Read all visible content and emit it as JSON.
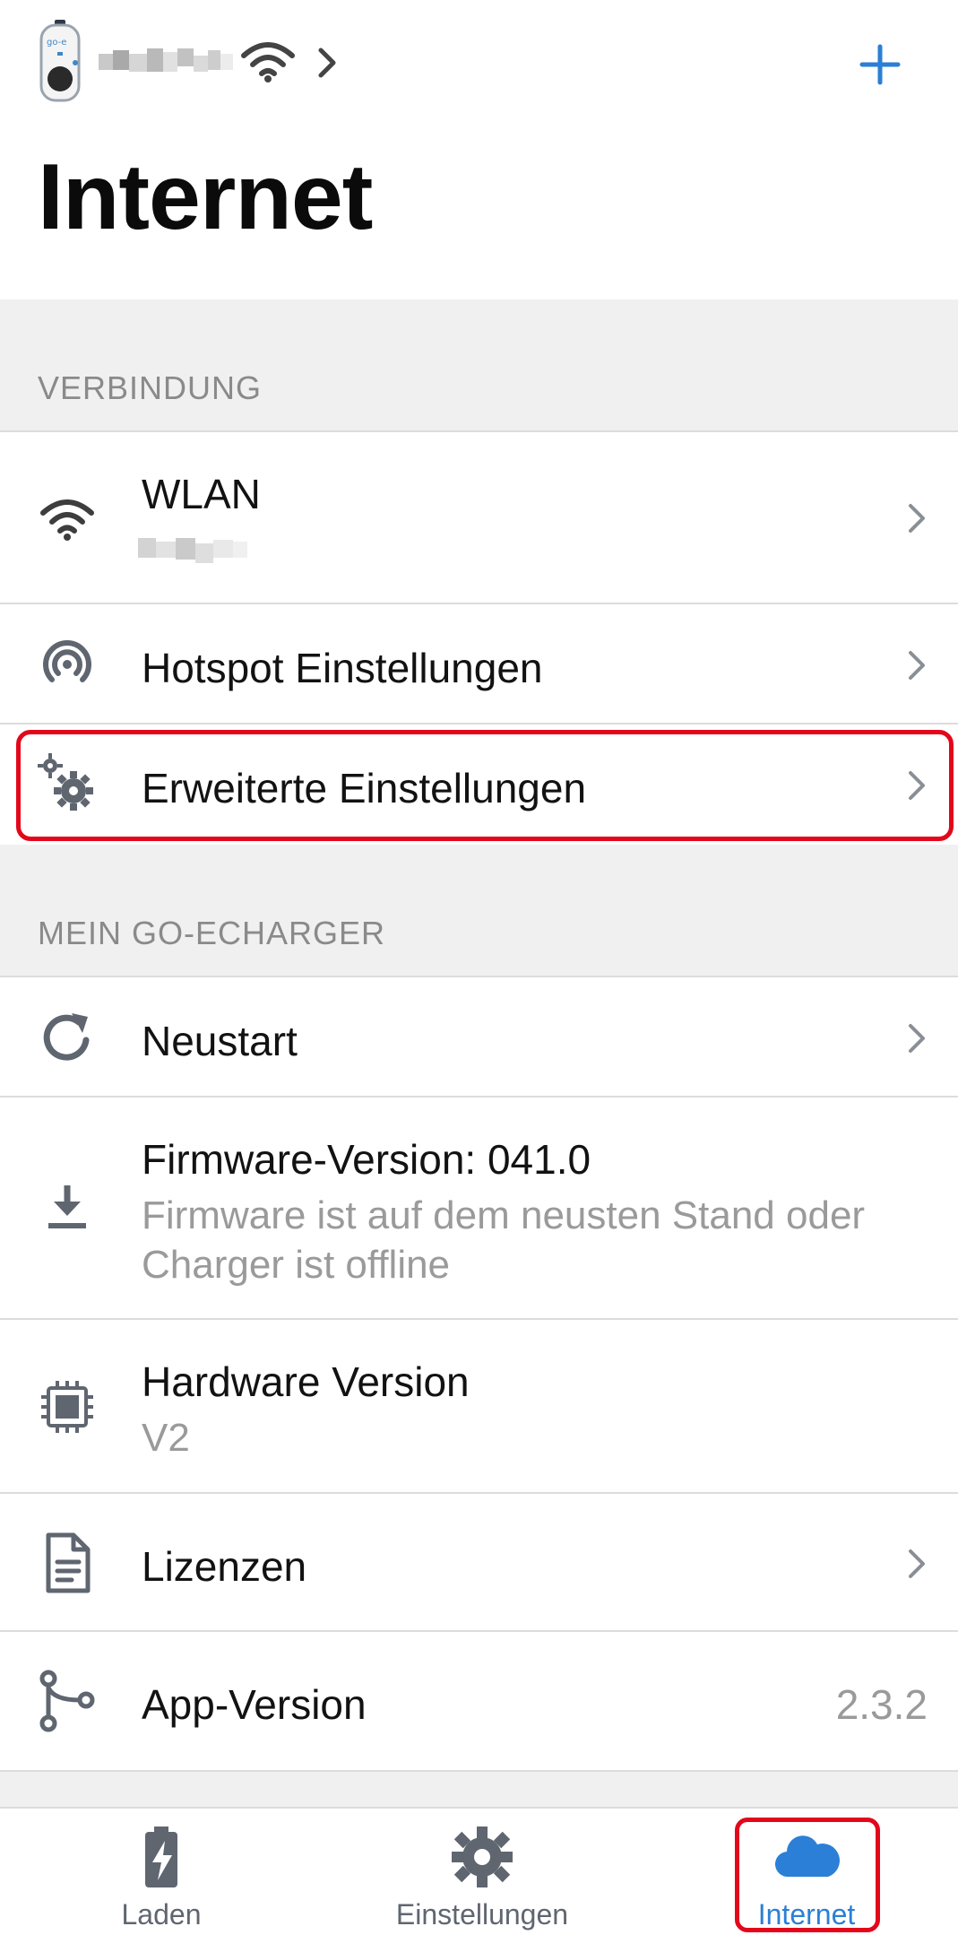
{
  "header": {
    "device_name": "",
    "title": "Internet"
  },
  "colors": {
    "accent": "#2b7fd6",
    "icon": "#5f6670",
    "highlight": "#e3071b",
    "section_bg": "#f0f0f0",
    "muted_text": "#9a9a9a"
  },
  "sections": {
    "verbindung": {
      "label": "VERBINDUNG",
      "items": [
        {
          "icon": "wifi-icon",
          "label": "WLAN",
          "sub": ""
        },
        {
          "icon": "hotspot-icon",
          "label": "Hotspot Einstellungen"
        },
        {
          "icon": "gears-icon",
          "label": "Erweiterte Einstellungen"
        }
      ]
    },
    "mein_go_echarger": {
      "label": "MEIN GO-ECHARGER",
      "items": [
        {
          "icon": "restart-icon",
          "label": "Neustart"
        },
        {
          "icon": "download-icon",
          "label": "Firmware-Version: 041.0",
          "sub": "Firmware ist auf dem neusten Stand oder Charger ist offline"
        },
        {
          "icon": "chip-icon",
          "label": "Hardware Version",
          "sub": "V2"
        },
        {
          "icon": "document-icon",
          "label": "Lizenzen"
        },
        {
          "icon": "branch-icon",
          "label": "App-Version",
          "value": "2.3.2"
        }
      ]
    }
  },
  "bottom_nav": [
    {
      "icon": "battery-charging-icon",
      "label": "Laden",
      "active": false
    },
    {
      "icon": "gear-icon",
      "label": "Einstellungen",
      "active": false
    },
    {
      "icon": "cloud-icon",
      "label": "Internet",
      "active": true
    }
  ]
}
